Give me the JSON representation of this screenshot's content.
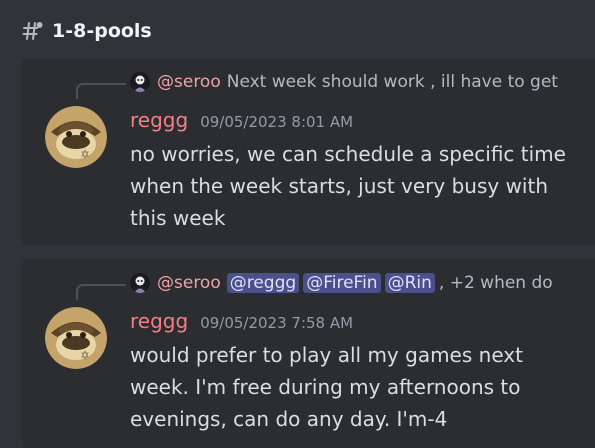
{
  "channel": {
    "name": "1-8-pools",
    "icon": "threaded-hash-icon"
  },
  "messages": [
    {
      "reply": {
        "author": "@seroo",
        "mentions": [],
        "text": "Next week should work , ill have to get"
      },
      "author": "reggg",
      "timestamp": "09/05/2023 8:01 AM",
      "lines": [
        "no worries, we can schedule a specific time",
        "when the week starts, just very busy with",
        "this week"
      ]
    },
    {
      "reply": {
        "author": "@seroo",
        "mentions": [
          "@reggg",
          "@FireFin",
          "@Rin"
        ],
        "text": ", +2 when do"
      },
      "author": "reggg",
      "timestamp": "09/05/2023 7:58 AM",
      "lines": [
        "would prefer to play all my games next",
        "week. I'm free during my afternoons to",
        "evenings, can do any day. I'm-4"
      ]
    }
  ],
  "colors": {
    "background": "#313338",
    "message_highlight": "#2b2d31",
    "username": "#f27f86",
    "reply_author": "#f0a3a6",
    "mention_bg": "#4b4f8a",
    "mention_text": "#dee0fc"
  }
}
